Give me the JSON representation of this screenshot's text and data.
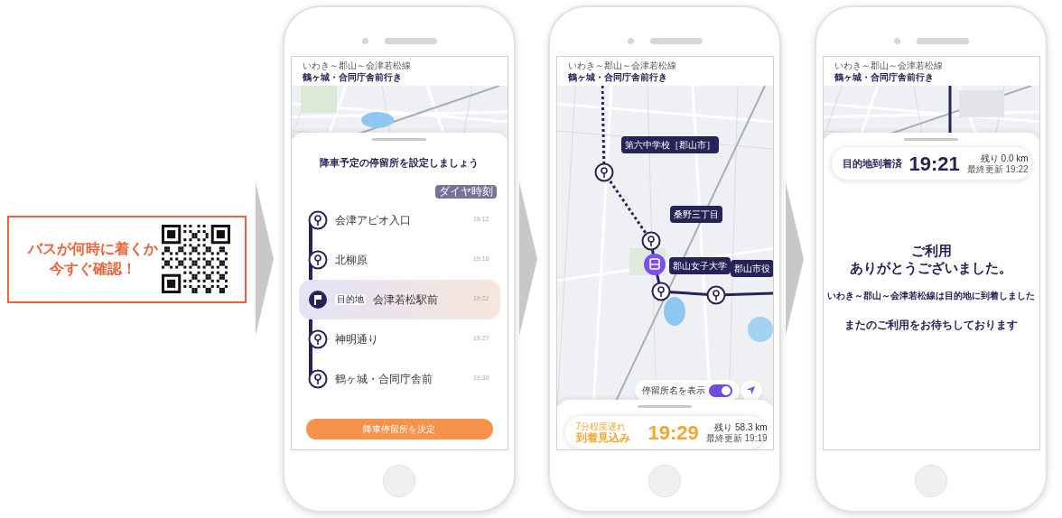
{
  "promo": {
    "lines": [
      "バスが何時に着くか",
      "今すぐ確認！"
    ]
  },
  "phones": [
    {
      "kind": "stop_select",
      "route": "いわき～郡山～会津若松線",
      "destination": "鶴ヶ城・合同庁舎前行き",
      "title": "降車予定の停留所を設定しましょう",
      "timetable_badge": "ダイヤ時刻",
      "destination_tag": "目的地",
      "stops": [
        {
          "name": "会津アピオ入口",
          "time": "19:12",
          "selected": false
        },
        {
          "name": "北柳原",
          "time": "19:16",
          "selected": false
        },
        {
          "name": "会津若松駅前",
          "time": "19:22",
          "selected": true
        },
        {
          "name": "神明通り",
          "time": "19:27",
          "selected": false
        },
        {
          "name": "鶴ヶ城・合同庁舎前",
          "time": "19:30",
          "selected": false
        }
      ],
      "button": "降車停留所を決定"
    },
    {
      "kind": "live_map",
      "route": "いわき～郡山～会津若松線",
      "destination": "鶴ヶ城・合同庁舎前行き",
      "map_stops": [
        {
          "label": "第六中学校［郡山市］"
        },
        {
          "label": "桑野三丁目"
        },
        {
          "label": "郡山女子大学"
        },
        {
          "label": "郡山市役"
        }
      ],
      "toggle": {
        "label": "停留所名を表示",
        "on": true
      },
      "status": {
        "delay": "7分程度遅れ",
        "caption": "到着見込み",
        "time": "19:29",
        "remaining": "残り 58.3 km",
        "updated": "最終更新 19:19"
      }
    },
    {
      "kind": "arrived",
      "route": "いわき～郡山～会津若松線",
      "destination": "鶴ヶ城・合同庁舎前行き",
      "status": {
        "caption": "目的地到着済",
        "time": "19:21",
        "remaining": "残り 0.0 km",
        "updated": "最終更新 19:22"
      },
      "thanks": [
        "ご利用",
        "ありがとうございました。"
      ],
      "message": "いわき～郡山～会津若松線は目的地に到着しました",
      "farewell": "またのご利用をお待ちしております"
    }
  ]
}
